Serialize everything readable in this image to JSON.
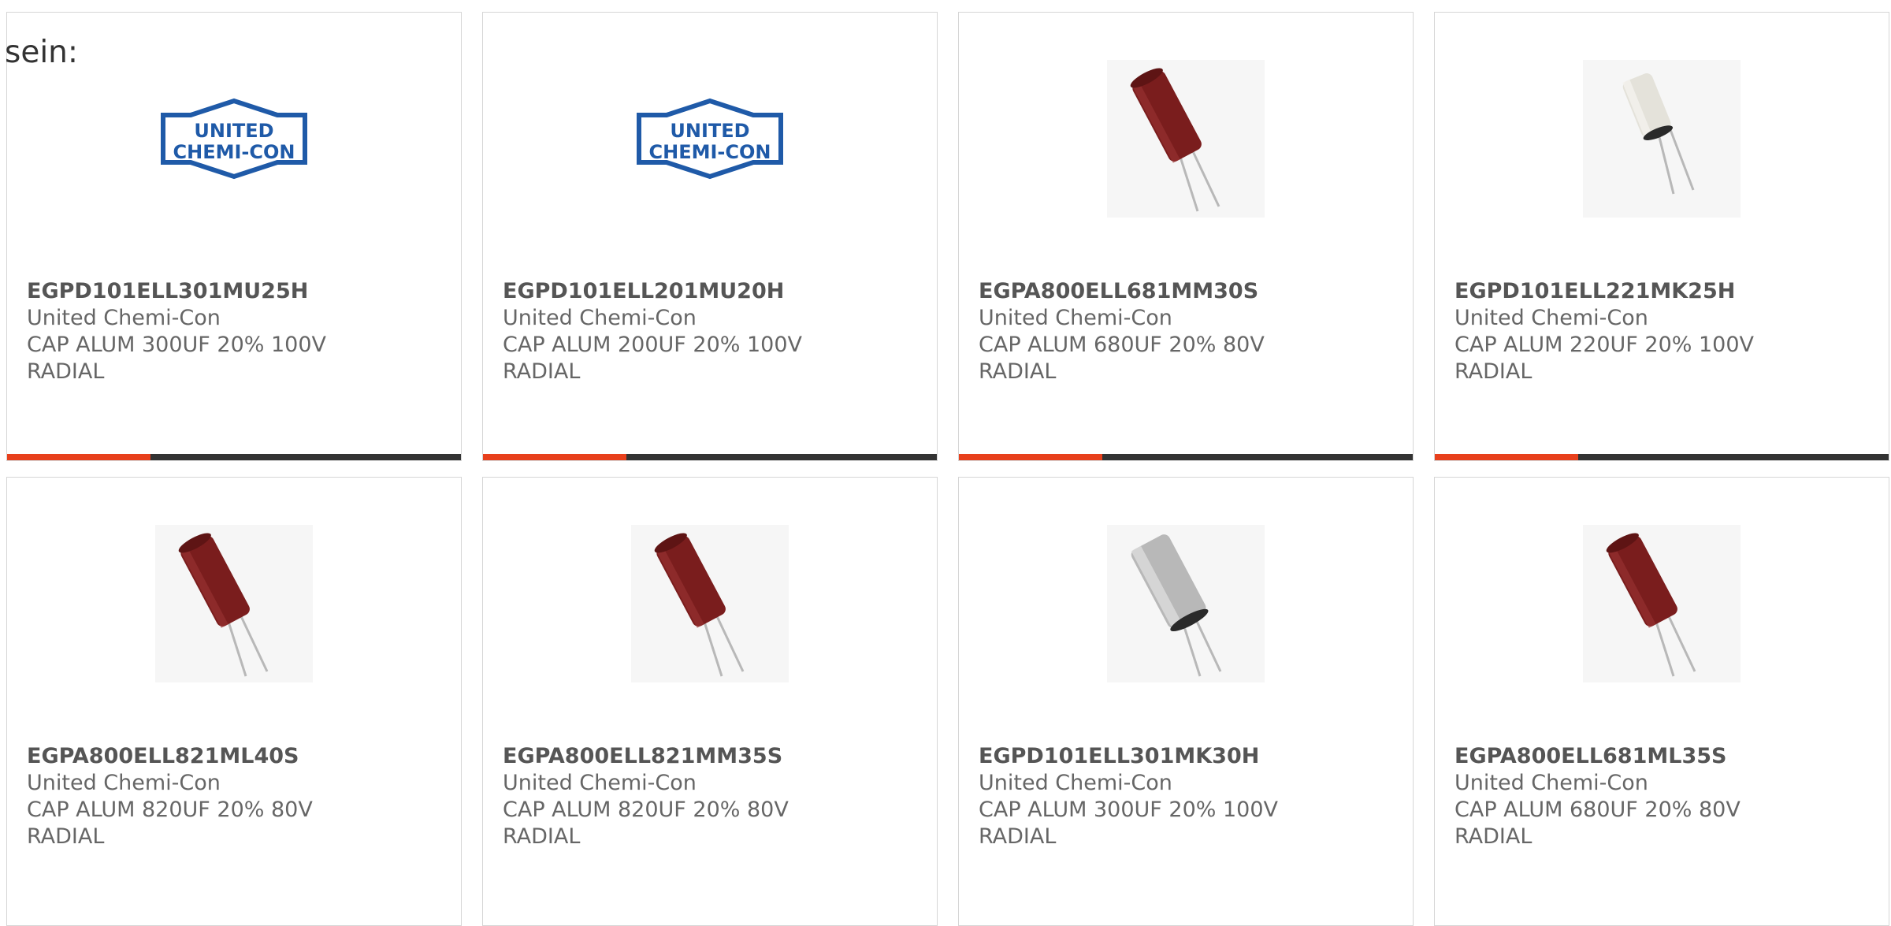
{
  "intro_text": "sein:",
  "brand_logo": {
    "line1": "UNITED",
    "line2": "CHEMI-CON",
    "color": "#1f5aa8"
  },
  "accent_color": "#e8401c",
  "products": [
    {
      "part_number": "EGPD101ELL301MU25H",
      "manufacturer": "United Chemi-Con",
      "description": "CAP ALUM 300UF 20% 100V",
      "package": "RADIAL",
      "image": "logo"
    },
    {
      "part_number": "EGPD101ELL201MU20H",
      "manufacturer": "United Chemi-Con",
      "description": "CAP ALUM 200UF 20% 100V",
      "package": "RADIAL",
      "image": "logo"
    },
    {
      "part_number": "EGPA800ELL681MM30S",
      "manufacturer": "United Chemi-Con",
      "description": "CAP ALUM 680UF 20% 80V",
      "package": "RADIAL",
      "image": "capacitor-red"
    },
    {
      "part_number": "EGPD101ELL221MK25H",
      "manufacturer": "United Chemi-Con",
      "description": "CAP ALUM 220UF 20% 100V",
      "package": "RADIAL",
      "image": "capacitor-white"
    },
    {
      "part_number": "EGPA800ELL821ML40S",
      "manufacturer": "United Chemi-Con",
      "description": "CAP ALUM 820UF 20% 80V",
      "package": "RADIAL",
      "image": "capacitor-red"
    },
    {
      "part_number": "EGPA800ELL821MM35S",
      "manufacturer": "United Chemi-Con",
      "description": "CAP ALUM 820UF 20% 80V",
      "package": "RADIAL",
      "image": "capacitor-red"
    },
    {
      "part_number": "EGPD101ELL301MK30H",
      "manufacturer": "United Chemi-Con",
      "description": "CAP ALUM 300UF 20% 100V",
      "package": "RADIAL",
      "image": "capacitor-silver"
    },
    {
      "part_number": "EGPA800ELL681ML35S",
      "manufacturer": "United Chemi-Con",
      "description": "CAP ALUM 680UF 20% 80V",
      "package": "RADIAL",
      "image": "capacitor-red"
    }
  ]
}
